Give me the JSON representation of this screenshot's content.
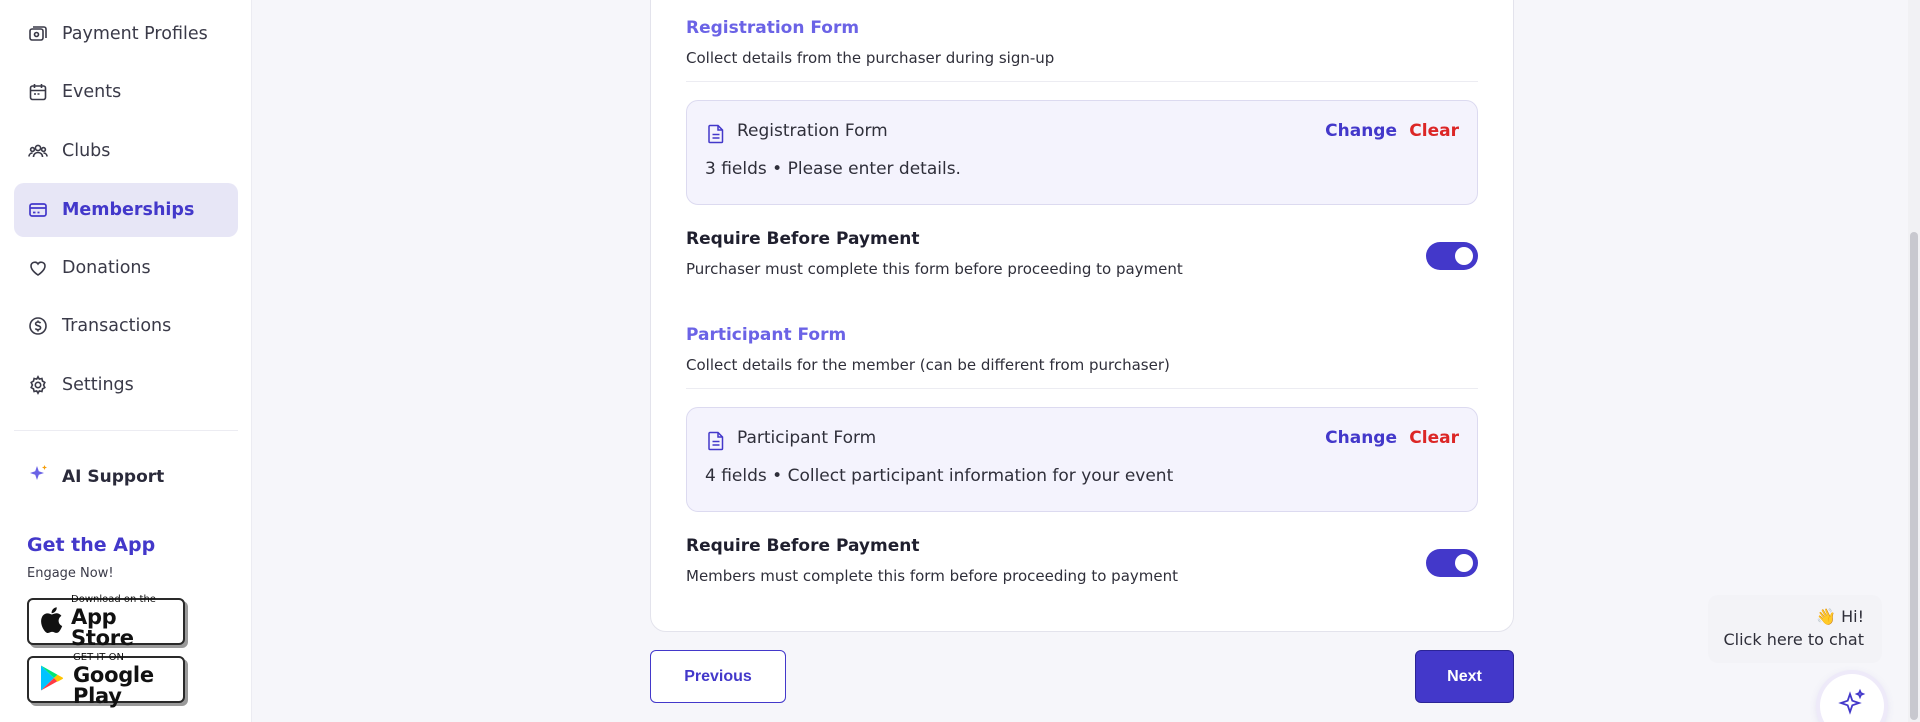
{
  "sidebar": {
    "items": [
      {
        "label": "Payment Profiles",
        "icon": "payment-profile-icon"
      },
      {
        "label": "Events",
        "icon": "calendar-icon"
      },
      {
        "label": "Clubs",
        "icon": "users-icon"
      },
      {
        "label": "Memberships",
        "icon": "membership-card-icon",
        "active": true
      },
      {
        "label": "Donations",
        "icon": "heart-icon"
      },
      {
        "label": "Transactions",
        "icon": "dollar-circle-icon"
      },
      {
        "label": "Settings",
        "icon": "gear-icon"
      }
    ],
    "ai_support": {
      "label": "AI Support",
      "icon": "sparkle-icon"
    },
    "get_app": {
      "title": "Get the App",
      "subtitle": "Engage Now!"
    },
    "app_store": {
      "small": "Download on the",
      "big": "App Store"
    },
    "google_play": {
      "small": "GET IT ON",
      "big": "Google Play"
    }
  },
  "registration": {
    "section_title": "Registration Form",
    "section_desc": "Collect details from the purchaser during sign-up",
    "form_name": "Registration Form",
    "change_label": "Change",
    "clear_label": "Clear",
    "fields_text": "3 fields • Please enter details.",
    "require_title": "Require Before Payment",
    "require_desc": "Purchaser must complete this form before proceeding to payment",
    "require_enabled": true
  },
  "participant": {
    "section_title": "Participant Form",
    "section_desc": "Collect details for the member (can be different from purchaser)",
    "form_name": "Participant Form",
    "change_label": "Change",
    "clear_label": "Clear",
    "fields_text": "4 fields • Collect participant information for your event",
    "require_title": "Require Before Payment",
    "require_desc": "Members must complete this form before proceeding to payment",
    "require_enabled": true
  },
  "nav": {
    "previous_label": "Previous",
    "next_label": "Next"
  },
  "chat": {
    "greeting": "👋 Hi!",
    "cta": "Click here to chat"
  },
  "colors": {
    "accent": "#4338ca",
    "section_title": "#6b63e6",
    "danger": "#dc2626",
    "active_bg": "#e7e6f6"
  }
}
